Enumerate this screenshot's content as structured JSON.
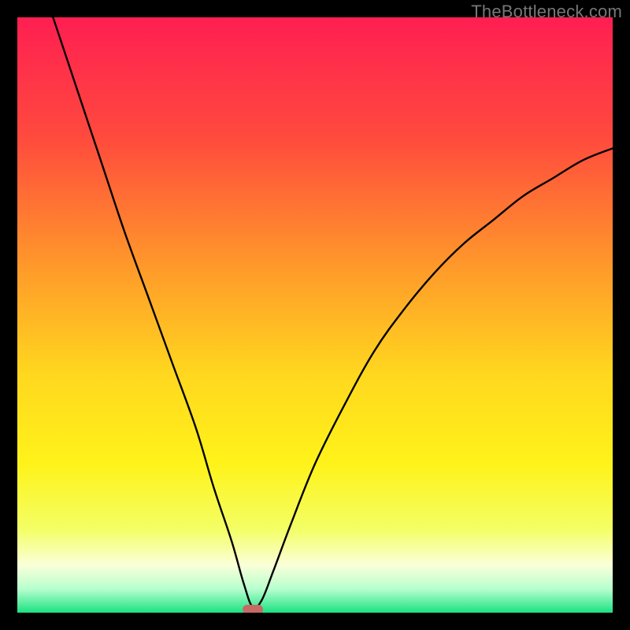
{
  "watermark": "TheBottleneck.com",
  "chart_data": {
    "type": "line",
    "title": "",
    "xlabel": "",
    "ylabel": "",
    "xlim": [
      0,
      100
    ],
    "ylim": [
      0,
      100
    ],
    "grid": false,
    "legend": false,
    "series": [
      {
        "name": "curve",
        "x": [
          6,
          10,
          14,
          18,
          22,
          26,
          30,
          33,
          36,
          38,
          39.5,
          41,
          43,
          46,
          50,
          55,
          60,
          65,
          70,
          75,
          80,
          85,
          90,
          95,
          100
        ],
        "y": [
          100,
          88,
          76,
          64,
          53,
          42,
          31,
          21,
          12,
          5,
          1,
          2,
          7,
          15,
          25,
          35,
          44,
          51,
          57,
          62,
          66,
          70,
          73,
          76,
          78
        ]
      }
    ],
    "minimum_marker": {
      "x": 39.5,
      "y": 0.5
    },
    "gradient_stops": [
      {
        "pct": 0,
        "color": "#ff1f52"
      },
      {
        "pct": 20,
        "color": "#ff4a3e"
      },
      {
        "pct": 42,
        "color": "#ff9a2a"
      },
      {
        "pct": 60,
        "color": "#ffd81f"
      },
      {
        "pct": 75,
        "color": "#fff31a"
      },
      {
        "pct": 86,
        "color": "#f4ff66"
      },
      {
        "pct": 92,
        "color": "#fbffd9"
      },
      {
        "pct": 96,
        "color": "#b8ffcf"
      },
      {
        "pct": 100,
        "color": "#1be283"
      }
    ]
  }
}
